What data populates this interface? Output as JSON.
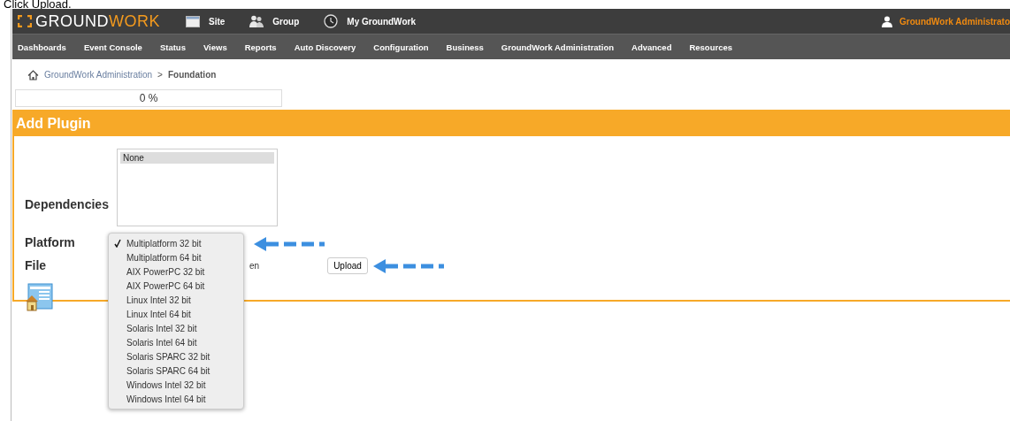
{
  "caption": "Click Upload.",
  "header": {
    "logo": [
      "GROUND",
      "WORK"
    ],
    "links": [
      {
        "kind": "site",
        "label": "Site"
      },
      {
        "kind": "group",
        "label": "Group"
      },
      {
        "kind": "clock",
        "label": "My GroundWork"
      }
    ],
    "user": "GroundWork Administrato"
  },
  "nav": [
    "Dashboards",
    "Event Console",
    "Status",
    "Views",
    "Reports",
    "Auto Discovery",
    "Configuration",
    "Business",
    "GroundWork Administration",
    "Advanced",
    "Resources"
  ],
  "breadcrumb": {
    "parent": "GroundWork Administration",
    "separator": ">",
    "current": "Foundation"
  },
  "progress": {
    "label": "0 %",
    "level": 0
  },
  "panel": {
    "title": "Add Plugin",
    "dependencies": {
      "label": "Dependencies",
      "options": [
        {
          "label": "None",
          "selected": true
        }
      ]
    },
    "platform": {
      "label": "Platform",
      "options": [
        {
          "label": "Multiplatform 32 bit",
          "selected": true
        },
        {
          "label": "Multiplatform 64 bit",
          "selected": false
        },
        {
          "label": "AIX PowerPC 32 bit",
          "selected": false
        },
        {
          "label": "AIX PowerPC 64 bit",
          "selected": false
        },
        {
          "label": "Linux Intel 32 bit",
          "selected": false
        },
        {
          "label": "Linux Intel 64 bit",
          "selected": false
        },
        {
          "label": "Solaris Intel 32 bit",
          "selected": false
        },
        {
          "label": "Solaris Intel 64 bit",
          "selected": false
        },
        {
          "label": "Solaris SPARC 32 bit",
          "selected": false
        },
        {
          "label": "Solaris SPARC 64 bit",
          "selected": false
        },
        {
          "label": "Windows Intel 32 bit",
          "selected": false
        },
        {
          "label": "Windows Intel 64 bit",
          "selected": false
        }
      ]
    },
    "file": {
      "label": "File",
      "status": "en",
      "button": "Upload"
    }
  }
}
